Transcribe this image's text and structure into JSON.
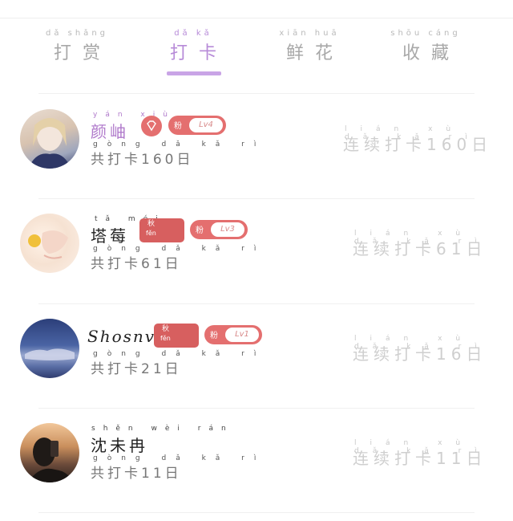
{
  "tabs": [
    {
      "pinyin": "dǎ shǎng",
      "label": "打赏",
      "active": false
    },
    {
      "pinyin": "dǎ kǎ",
      "label": "打卡",
      "active": true
    },
    {
      "pinyin": "xiān huā",
      "label": "鲜花",
      "active": false
    },
    {
      "pinyin": "shōu cáng",
      "label": "收藏",
      "active": false
    }
  ],
  "badges": {
    "fan_label": "粉",
    "title_badge_top": "秋",
    "title_badge_bottom_py": "fěn"
  },
  "users": [
    {
      "name_pinyin": "yán xiù",
      "name": "颜岫",
      "vip": true,
      "level": "Lv4",
      "total_pinyin": "gòng dǎ kǎ rì",
      "total": "共打卡160日",
      "streak_pinyin": "lián xù dǎ kǎ rì",
      "streak": "连续打卡160日"
    },
    {
      "name_pinyin": "tǎ méi",
      "name": "塔莓",
      "vip": false,
      "level": "Lv3",
      "total_pinyin": "gòng dǎ kǎ rì",
      "total": "共打卡61日",
      "streak_pinyin": "lián xù dǎ kǎ rì",
      "streak": "连续打卡61日"
    },
    {
      "name_pinyin": "",
      "name": "Shosnvx",
      "vip": false,
      "level": "Lv1",
      "total_pinyin": "gòng dǎ kǎ rì",
      "total": "共打卡21日",
      "streak_pinyin": "lián xù dǎ kǎ rì",
      "streak": "连续打卡16日"
    },
    {
      "name_pinyin": "shěn wèi rán",
      "name": "沈未冉",
      "vip": false,
      "level": "",
      "total_pinyin": "gòng dǎ kǎ rì",
      "total": "共打卡11日",
      "streak_pinyin": "lián xù dǎ kǎ rì",
      "streak": "连续打卡11日"
    }
  ],
  "colors": {
    "accent": "#c9a4e6",
    "vip_name": "#b07acb",
    "badge_red": "#e46f6f"
  }
}
